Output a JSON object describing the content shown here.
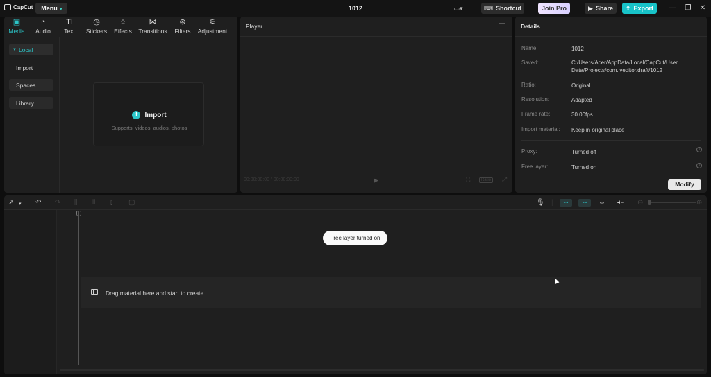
{
  "app": {
    "logo_text": "CapCut",
    "title": "1012"
  },
  "titlebar": {
    "menu_label": "Menu",
    "shortcut_label": "Shortcut",
    "joinpro_label": "Join Pro",
    "share_label": "Share",
    "export_label": "Export",
    "accent": "#18c3c8"
  },
  "media": {
    "tabs": [
      {
        "label": "Media",
        "icon": "media-icon"
      },
      {
        "label": "Audio",
        "icon": "audio-icon"
      },
      {
        "label": "Text",
        "icon": "text-icon"
      },
      {
        "label": "Stickers",
        "icon": "stickers-icon"
      },
      {
        "label": "Effects",
        "icon": "effects-icon"
      },
      {
        "label": "Transitions",
        "icon": "transitions-icon"
      },
      {
        "label": "Filters",
        "icon": "filters-icon"
      },
      {
        "label": "Adjustment",
        "icon": "adjustment-icon"
      }
    ],
    "sidebar": [
      "Local",
      "Import",
      "Spaces",
      "Library"
    ],
    "import_label": "Import",
    "import_sub": "Supports: videos, audios, photos"
  },
  "player": {
    "title": "Player",
    "timecode": "00:00:00:00 / 00:00:00:00",
    "ratio_label": "Ratio"
  },
  "details": {
    "title": "Details",
    "rows": [
      {
        "label": "Name:",
        "value": "1012"
      },
      {
        "label": "Saved:",
        "value": "C:/Users/Acer/AppData/Local/CapCut/User Data/Projects/com.lveditor.draft/1012"
      },
      {
        "label": "Ratio:",
        "value": "Original"
      },
      {
        "label": "Resolution:",
        "value": "Adapted"
      },
      {
        "label": "Frame rate:",
        "value": "30.00fps"
      },
      {
        "label": "Import material:",
        "value": "Keep in original place"
      },
      {
        "label": "Proxy:",
        "value": "Turned off"
      },
      {
        "label": "Free layer:",
        "value": "Turned on"
      }
    ],
    "modify_label": "Modify"
  },
  "timeline": {
    "drop_text": "Drag material here and start to create",
    "toast": "Free layer turned on"
  }
}
